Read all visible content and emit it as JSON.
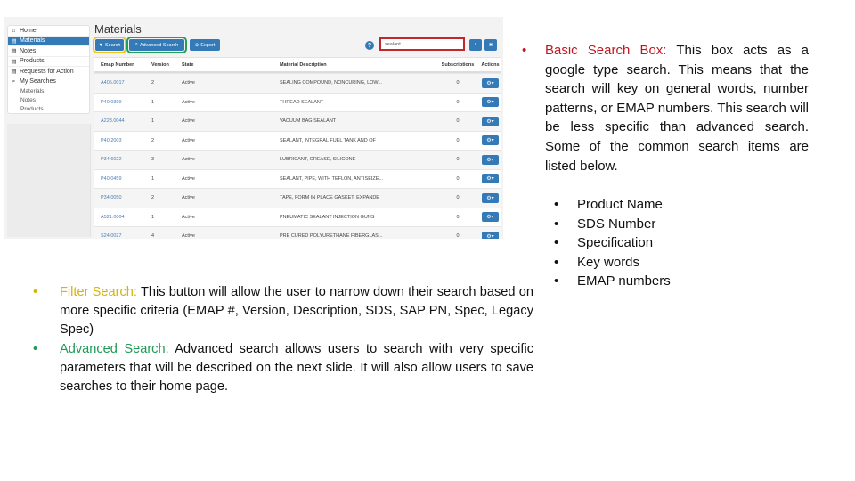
{
  "app": {
    "sidebar": {
      "items": [
        {
          "icon": "home-icon",
          "glyph": "⌂",
          "label": "Home",
          "active": false
        },
        {
          "icon": "document-icon",
          "glyph": "▤",
          "label": "Materials",
          "active": true
        },
        {
          "icon": "document-icon",
          "glyph": "▤",
          "label": "Notes",
          "active": false
        },
        {
          "icon": "document-icon",
          "glyph": "▤",
          "label": "Products",
          "active": false
        },
        {
          "icon": "document-icon",
          "glyph": "▤",
          "label": "Requests for Action",
          "active": false
        }
      ],
      "my_searches": {
        "glyph": "⌕",
        "label": "My Searches",
        "items": [
          "Materials",
          "Notes",
          "Products"
        ]
      }
    },
    "page_title": "Materials",
    "toolbar": {
      "search_label": "Search",
      "search_glyph": "▼",
      "advanced_label": "Advanced Search",
      "advanced_glyph": "⌕",
      "export_label": "Export",
      "export_glyph": "⊕",
      "help_glyph": "?",
      "search_value": "sealant",
      "go_glyph": "⌕",
      "clear_glyph": "✖"
    },
    "table": {
      "headers": [
        "Emap Number",
        "Version",
        "State",
        "Material Description",
        "Subscriptions",
        "Actions"
      ],
      "action_glyph": "⚙▾",
      "rows": [
        {
          "emap": "A405.0017",
          "version": "2",
          "state": "Active",
          "description": "SEALING COMPOUND, NONCURING, LOW...",
          "subs": "0"
        },
        {
          "emap": "P40.0399",
          "version": "1",
          "state": "Active",
          "description": "THREAD SEALANT",
          "subs": "0"
        },
        {
          "emap": "A223.0044",
          "version": "1",
          "state": "Active",
          "description": "VACUUM BAG SEALANT",
          "subs": "0"
        },
        {
          "emap": "P40.2003",
          "version": "2",
          "state": "Active",
          "description": "SEALANT, INTEGRAL FUEL TANK AND OF",
          "subs": "0"
        },
        {
          "emap": "P34.6022",
          "version": "3",
          "state": "Active",
          "description": "LUBRICANT, GREASE, SILICONE",
          "subs": "0"
        },
        {
          "emap": "P40.0459",
          "version": "1",
          "state": "Active",
          "description": "SEALANT, PIPE, WITH TEFLON, ANTISEIZE...",
          "subs": "0"
        },
        {
          "emap": "P34.0050",
          "version": "2",
          "state": "Active",
          "description": "TAPE, FORM IN PLACE GASKET, EXPANDE",
          "subs": "0"
        },
        {
          "emap": "A521.0004",
          "version": "1",
          "state": "Active",
          "description": "PNEUMATIC SEALANT INJECTION GUNS",
          "subs": "0"
        },
        {
          "emap": "S24.0027",
          "version": "4",
          "state": "Active",
          "description": "PRE CURED POLYURETHANE FIBERGLAS...",
          "subs": "0"
        }
      ]
    }
  },
  "slide": {
    "bullet_glyph": "•",
    "basic": {
      "term": "Basic Search Box:",
      "text": " This box acts as a google type search. This means that the search will key on general words, number patterns, or EMAP numbers. This search will be less specific than advanced search. Some of the common search items are listed below."
    },
    "common_items": [
      "Product Name",
      "SDS Number",
      "Specification",
      "Key words",
      "EMAP numbers"
    ],
    "filter": {
      "term": "Filter Search:",
      "text": " This button will allow the user to narrow down their search based on more specific criteria (EMAP #, Version, Description, SDS, SAP PN, Spec, Legacy Spec)"
    },
    "advanced": {
      "term": "Advanced Search:",
      "text": " Advanced search allows users to search with very specific parameters that will be described on the next slide. It will also allow users to save searches to their home page."
    },
    "colors": {
      "basic": "#c0181f",
      "filter": "#d8b400",
      "advanced": "#1f9a55",
      "highlight_filter": "#f2c318",
      "highlight_advanced": "#22a05a",
      "highlight_basic": "#c1272d",
      "primary_button": "#337ab7"
    }
  }
}
